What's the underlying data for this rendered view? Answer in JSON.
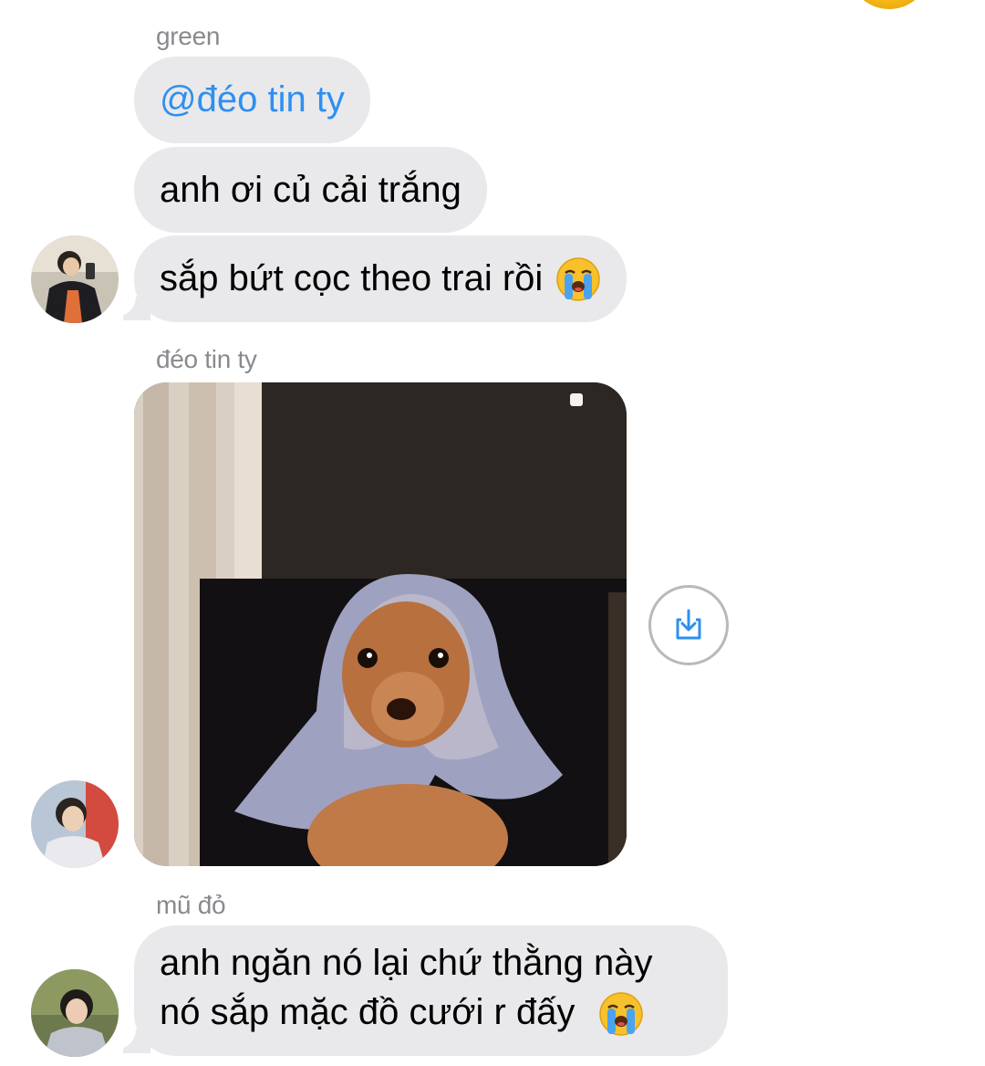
{
  "messages": [
    {
      "sender": "green",
      "text": "@đéo tin ty",
      "type": "mention"
    },
    {
      "text": "anh ơi củ cải trắng"
    },
    {
      "text": "sắp bứt cọc theo trai rồi",
      "emoji": "loudly-crying-face"
    },
    {
      "sender": "đéo tin ty",
      "type": "image",
      "image_alt": "chihuahua wearing headscarf photo"
    },
    {
      "sender": "mũ đỏ",
      "lines": [
        "anh ngăn nó lại chứ thằng này",
        "nó sắp mặc đồ cưới r đấy"
      ],
      "emoji": "loudly-crying-face"
    }
  ],
  "colors": {
    "bubble": "#e9e9eb",
    "mention": "#2f8ff0",
    "sender_name": "#8a8a8e",
    "save_icon": "#2f8ff0"
  }
}
